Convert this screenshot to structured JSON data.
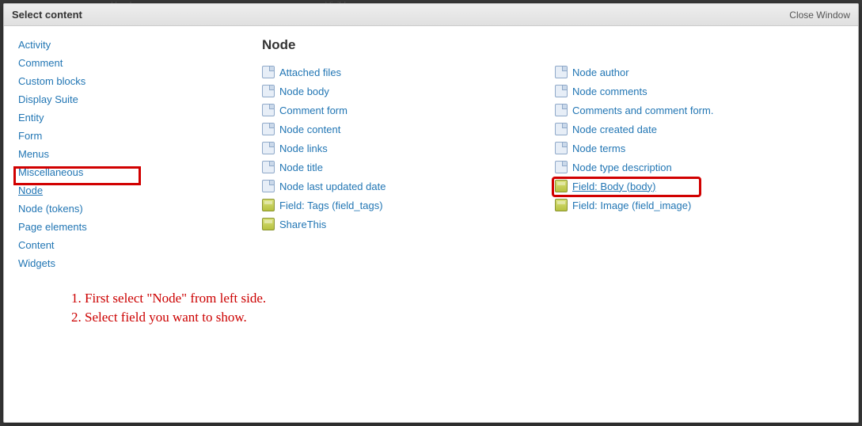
{
  "bg_hint_left": "Header",
  "bg_hint_right": "Visible",
  "header": {
    "title": "Select content",
    "close": "Close Window"
  },
  "sidebar": {
    "items": [
      {
        "label": "Activity"
      },
      {
        "label": "Comment"
      },
      {
        "label": "Custom blocks"
      },
      {
        "label": "Display Suite"
      },
      {
        "label": "Entity"
      },
      {
        "label": "Form"
      },
      {
        "label": "Menus"
      },
      {
        "label": "Miscellaneous"
      },
      {
        "label": "Node",
        "active": true
      },
      {
        "label": "Node (tokens)"
      },
      {
        "label": "Page elements"
      },
      {
        "label": "Content"
      },
      {
        "label": "Widgets"
      }
    ]
  },
  "main": {
    "heading": "Node",
    "col1": [
      {
        "icon": "doc",
        "label": "Attached files"
      },
      {
        "icon": "doc",
        "label": "Node body"
      },
      {
        "icon": "doc",
        "label": "Comment form"
      },
      {
        "icon": "doc",
        "label": "Node content"
      },
      {
        "icon": "doc",
        "label": "Node links"
      },
      {
        "icon": "doc",
        "label": "Node title"
      },
      {
        "icon": "doc",
        "label": "Node last updated date"
      },
      {
        "icon": "box",
        "label": "Field: Tags (field_tags)"
      },
      {
        "icon": "box",
        "label": "ShareThis"
      }
    ],
    "col2": [
      {
        "icon": "doc",
        "label": "Node author"
      },
      {
        "icon": "doc",
        "label": "Node comments"
      },
      {
        "icon": "doc",
        "label": "Comments and comment form."
      },
      {
        "icon": "doc",
        "label": "Node created date"
      },
      {
        "icon": "doc",
        "label": "Node terms"
      },
      {
        "icon": "doc",
        "label": "Node type description"
      },
      {
        "icon": "box",
        "label": "Field: Body (body)",
        "underlined": true
      },
      {
        "icon": "box",
        "label": "Field: Image (field_image)"
      }
    ]
  },
  "annotations": {
    "line1": "1. First select \"Node\" from left side.",
    "line2": "2. Select field you want to show."
  }
}
